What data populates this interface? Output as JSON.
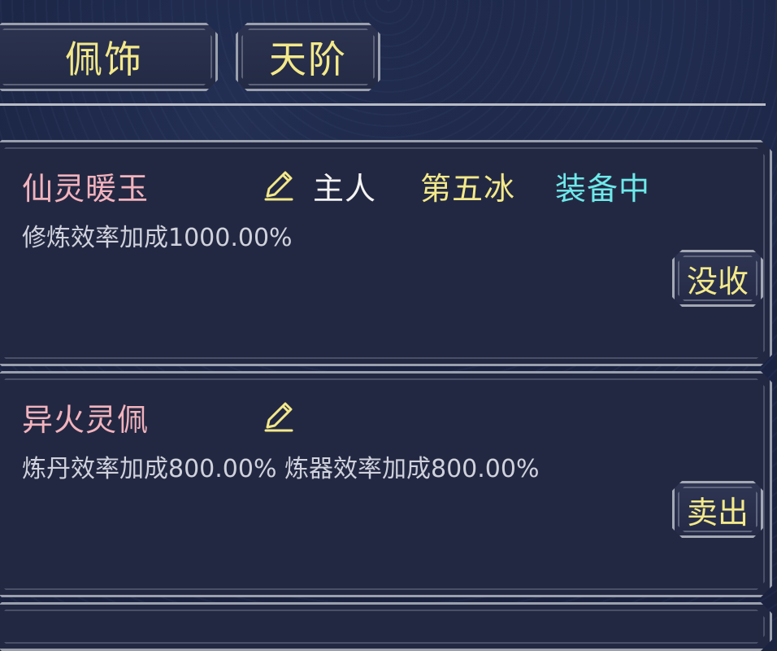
{
  "tabs": [
    {
      "label": "佩饰"
    },
    {
      "label": "天阶"
    }
  ],
  "items": [
    {
      "name": "仙灵暖玉",
      "owner": "主人",
      "holder": "第五冰",
      "status": "装备中",
      "effect": "修炼效率加成1000.00%",
      "action": "没收"
    },
    {
      "name": "异火灵佩",
      "owner": "",
      "holder": "",
      "status": "",
      "effect": "炼丹效率加成800.00% 炼器效率加成800.00%",
      "action": "卖出"
    }
  ],
  "colors": {
    "background": "#1a2340",
    "item_name": "#f2b3bd",
    "accent_yellow": "#f3e98a",
    "status_cyan": "#6ee9ea",
    "effect_text": "#cfd2dc",
    "border": "#9aa0ad"
  },
  "icons": {
    "edit": "pencil-icon"
  }
}
